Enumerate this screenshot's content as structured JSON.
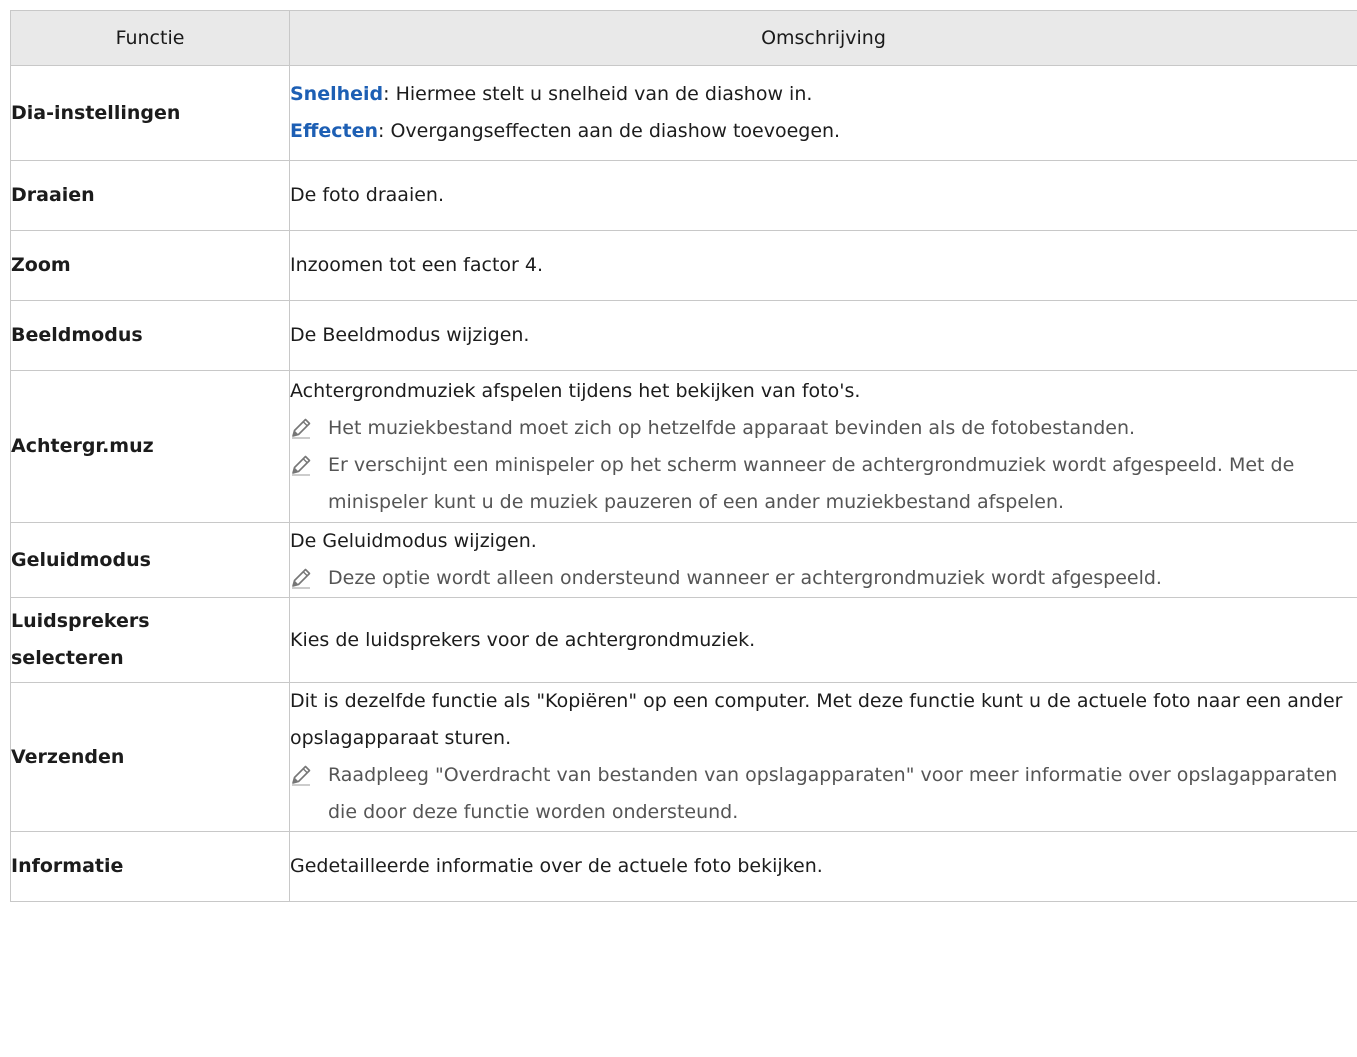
{
  "header": {
    "col1": "Functie",
    "col2": "Omschrijving"
  },
  "rows": [
    {
      "name": "Dia-instellingen",
      "items": [
        {
          "type": "kv",
          "key": "Snelheid",
          "text": ": Hiermee stelt u snelheid van de diashow in."
        },
        {
          "type": "kv",
          "key": "Effecten",
          "text": ": Overgangseffecten aan de diashow toevoegen."
        }
      ]
    },
    {
      "name": "Draaien",
      "items": [
        {
          "type": "text",
          "text": "De foto draaien."
        }
      ]
    },
    {
      "name": "Zoom",
      "items": [
        {
          "type": "text",
          "text": "Inzoomen tot een factor 4."
        }
      ]
    },
    {
      "name": "Beeldmodus",
      "items": [
        {
          "type": "text",
          "text": "De Beeldmodus wijzigen."
        }
      ]
    },
    {
      "name": "Achtergr.muz",
      "items": [
        {
          "type": "text",
          "text": "Achtergrondmuziek afspelen tijdens het bekijken van foto's."
        },
        {
          "type": "note",
          "text": "Het muziekbestand moet zich op hetzelfde apparaat bevinden als de fotobestanden."
        },
        {
          "type": "note",
          "text": "Er verschijnt een minispeler op het scherm wanneer de achtergrondmuziek wordt afgespeeld. Met de minispeler kunt u de muziek pauzeren of een ander muziekbestand afspelen."
        }
      ]
    },
    {
      "name": "Geluidmodus",
      "items": [
        {
          "type": "text",
          "text": "De Geluidmodus wijzigen."
        },
        {
          "type": "note",
          "text": "Deze optie wordt alleen ondersteund wanneer er achtergrondmuziek wordt afgespeeld."
        }
      ]
    },
    {
      "name": "Luidsprekers selecteren",
      "items": [
        {
          "type": "text",
          "text": "Kies de luidsprekers voor de achtergrondmuziek."
        }
      ]
    },
    {
      "name": "Verzenden",
      "items": [
        {
          "type": "text",
          "text": "Dit is dezelfde functie als \"Kopiëren\" op een computer. Met deze functie kunt u de actuele foto naar een ander opslagapparaat sturen."
        },
        {
          "type": "note",
          "text": "Raadpleeg \"Overdracht van bestanden van opslagapparaten\" voor meer informatie over opslagapparaten die door deze functie worden ondersteund."
        }
      ]
    },
    {
      "name": "Informatie",
      "items": [
        {
          "type": "text",
          "text": "Gedetailleerde informatie over de actuele foto bekijken."
        }
      ]
    }
  ],
  "colors": {
    "keyword": "#1d5fb4",
    "header_bg": "#e9e9e9",
    "border": "#c8c8c8",
    "note_text": "#555555"
  },
  "icons": {
    "note": "pencil-icon"
  }
}
